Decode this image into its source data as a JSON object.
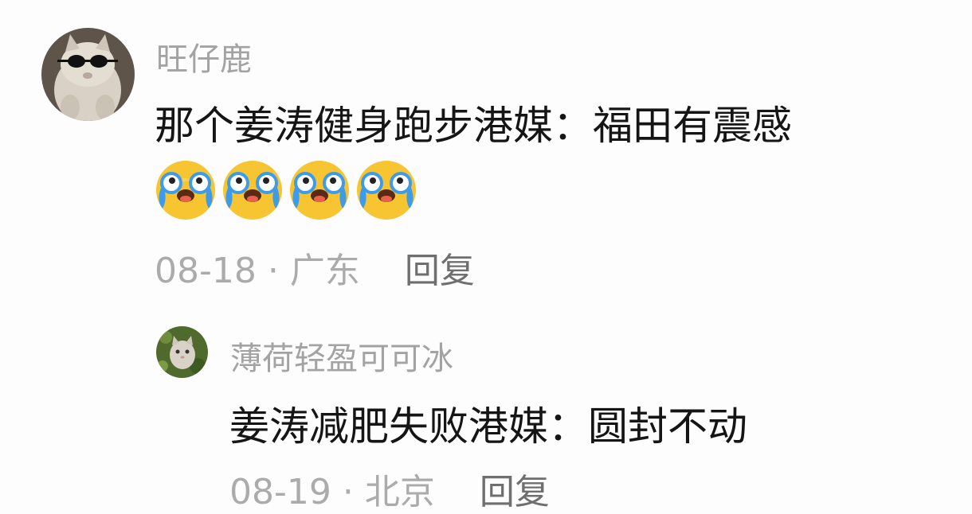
{
  "comments": [
    {
      "username": "旺仔鹿",
      "avatar_icon": "cat-with-sunglasses-avatar",
      "text": "那个姜涛健身跑步港媒：福田有震感",
      "emojis": [
        "crying-laughing-emoji",
        "crying-laughing-emoji",
        "crying-laughing-emoji",
        "crying-laughing-emoji"
      ],
      "date": "08-18",
      "separator": "·",
      "location": "广东",
      "reply_label": "回复"
    },
    {
      "username": "薄荷轻盈可可冰",
      "avatar_icon": "cat-in-grass-avatar",
      "text": "姜涛减肥失败港媒：圆封不动",
      "date": "08-19",
      "separator": "·",
      "location": "北京",
      "reply_label": "回复"
    }
  ],
  "colors": {
    "username": "#a3a3a3",
    "content": "#151515",
    "meta": "#ababab",
    "reply": "#6f6f6f",
    "emoji_face": "#f6c531",
    "emoji_tears": "#3d9be9"
  }
}
